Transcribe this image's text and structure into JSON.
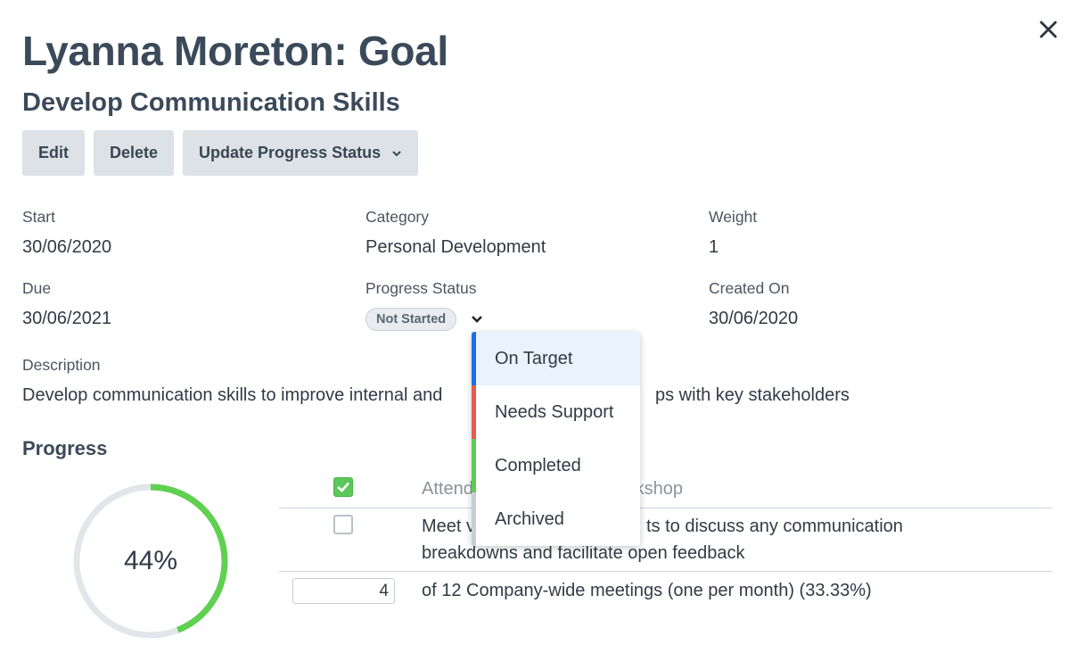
{
  "header": {
    "title": "Lyanna Moreton: Goal",
    "subtitle": "Develop Communication Skills"
  },
  "toolbar": {
    "edit_label": "Edit",
    "delete_label": "Delete",
    "update_label": "Update Progress Status"
  },
  "fields": {
    "start": {
      "label": "Start",
      "value": "30/06/2020"
    },
    "category": {
      "label": "Category",
      "value": "Personal Development"
    },
    "weight": {
      "label": "Weight",
      "value": "1"
    },
    "due": {
      "label": "Due",
      "value": "30/06/2021"
    },
    "progress_status": {
      "label": "Progress Status",
      "value": "Not Started"
    },
    "created_on": {
      "label": "Created On",
      "value": "30/06/2020"
    }
  },
  "description": {
    "label": "Description",
    "text_before": "Develop communication skills to improve internal and",
    "text_after": "ps with key stakeholders"
  },
  "progress": {
    "title": "Progress",
    "percent": 44,
    "percent_label": "44%",
    "tasks": [
      {
        "checked": true,
        "text_a": "Attend",
        "text_b": "rkshop"
      },
      {
        "checked": false,
        "text_a": "Meet v",
        "text_b": "ts to discuss any communication",
        "line2": "breakdowns and facilitate open feedback"
      }
    ],
    "counter": {
      "value": "4",
      "text": "of 12 Company-wide meetings (one per month) (33.33%)"
    }
  },
  "status_menu": {
    "items": [
      {
        "label": "On Target",
        "color": "#1a6fe8",
        "highlighted": true
      },
      {
        "label": "Needs Support",
        "color": "#e65a50",
        "highlighted": false
      },
      {
        "label": "Completed",
        "color": "#5cce4f",
        "highlighted": false
      },
      {
        "label": "Archived",
        "color": "#c9ced4",
        "highlighted": false
      }
    ]
  },
  "colors": {
    "progress_ring": "#5fd04f",
    "ring_track": "#e1e6ea"
  },
  "icons": {
    "close": "close-icon",
    "update_chevron": "chevron-down-icon",
    "status_chevron": "chevron-down-icon",
    "checked_box": "check-icon"
  }
}
